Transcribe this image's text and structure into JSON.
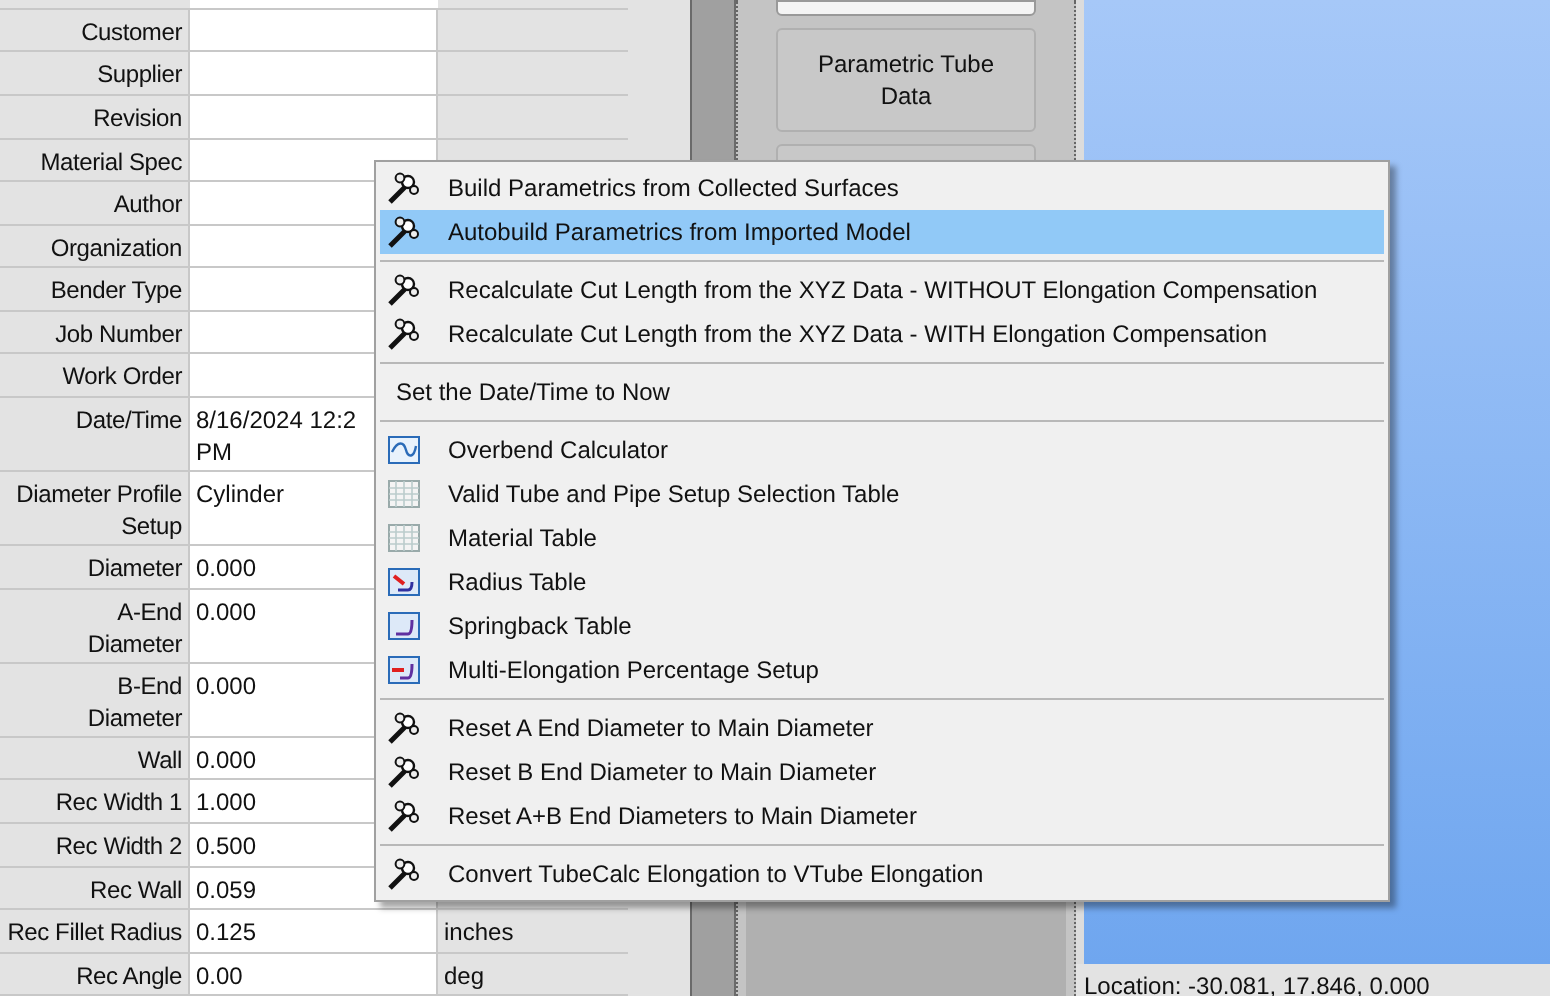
{
  "table": {
    "rows": [
      {
        "label": "Customer",
        "value": "",
        "unit": ""
      },
      {
        "label": "Supplier",
        "value": "",
        "unit": ""
      },
      {
        "label": "Revision",
        "value": "",
        "unit": ""
      },
      {
        "label": "Material Spec",
        "value": "",
        "unit": ""
      },
      {
        "label": "Author",
        "value": "",
        "unit": ""
      },
      {
        "label": "Organization",
        "value": "",
        "unit": ""
      },
      {
        "label": "Bender Type",
        "value": "",
        "unit": ""
      },
      {
        "label": "Job Number",
        "value": "",
        "unit": ""
      },
      {
        "label": "Work Order",
        "value": "",
        "unit": ""
      },
      {
        "label": "Date/Time",
        "value": "8/16/2024 12:2\nPM",
        "unit": ""
      },
      {
        "label": "Diameter Profile\nSetup",
        "value": "Cylinder",
        "unit": ""
      },
      {
        "label": "Diameter",
        "value": "0.000",
        "unit": ""
      },
      {
        "label": "A-End\nDiameter",
        "value": "0.000",
        "unit": ""
      },
      {
        "label": "B-End\nDiameter",
        "value": "0.000",
        "unit": ""
      },
      {
        "label": "Wall",
        "value": "0.000",
        "unit": ""
      },
      {
        "label": "Rec Width 1",
        "value": "1.000",
        "unit": ""
      },
      {
        "label": "Rec Width 2",
        "value": "0.500",
        "unit": ""
      },
      {
        "label": "Rec Wall",
        "value": "0.059",
        "unit": ""
      },
      {
        "label": "Rec Fillet Radius",
        "value": "0.125",
        "unit": "inches"
      },
      {
        "label": "Rec Angle",
        "value": "0.00",
        "unit": "deg"
      }
    ]
  },
  "side_panel": {
    "buttons": [
      "Parametric Tube Data"
    ]
  },
  "status_bar": {
    "location": "Location: -30.081, 17.846, 0.000"
  },
  "context_menu": {
    "items": [
      {
        "kind": "wand",
        "label": "Build Parametrics from Collected Surfaces",
        "selected": false
      },
      {
        "kind": "wand",
        "label": "Autobuild Parametrics from Imported Model",
        "selected": true
      },
      {
        "kind": "separator"
      },
      {
        "kind": "wand",
        "label": "Recalculate Cut Length from the XYZ Data - WITHOUT Elongation Compensation",
        "selected": false
      },
      {
        "kind": "wand",
        "label": "Recalculate Cut Length from the XYZ Data - WITH Elongation Compensation",
        "selected": false
      },
      {
        "kind": "separator"
      },
      {
        "kind": "plain",
        "label": "Set the Date/Time to Now",
        "selected": false
      },
      {
        "kind": "separator"
      },
      {
        "kind": "wave",
        "label": "Overbend Calculator",
        "selected": false
      },
      {
        "kind": "grid",
        "label": "Valid Tube and Pipe Setup Selection Table",
        "selected": false
      },
      {
        "kind": "grid",
        "label": "Material Table",
        "selected": false
      },
      {
        "kind": "radius",
        "label": "Radius Table",
        "selected": false
      },
      {
        "kind": "springback",
        "label": "Springback Table",
        "selected": false
      },
      {
        "kind": "multi",
        "label": "Multi-Elongation Percentage Setup",
        "selected": false
      },
      {
        "kind": "separator"
      },
      {
        "kind": "wand",
        "label": "Reset A End Diameter to Main Diameter",
        "selected": false
      },
      {
        "kind": "wand",
        "label": "Reset B End Diameter to Main Diameter",
        "selected": false
      },
      {
        "kind": "wand",
        "label": "Reset A+B End Diameters to Main Diameter",
        "selected": false
      },
      {
        "kind": "separator"
      },
      {
        "kind": "wand",
        "label": "Convert TubeCalc Elongation to VTube Elongation",
        "selected": false
      }
    ]
  }
}
